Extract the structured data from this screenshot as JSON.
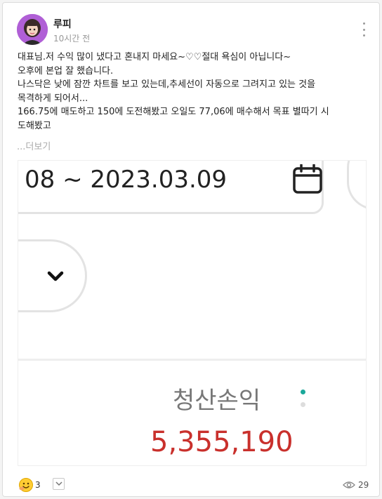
{
  "post": {
    "author": "루피",
    "time": "10시간 전",
    "body": "대표님.저 수익 많이  냈다고 혼내지 마세요~♡♡절대 욕심이 아닙니다~\n오후에 본업 잘 했습니다.\n나스닥은 낮에 잠깐 차트를 보고  있는데,추세선이 자동으로 그려지고 있는 것을\n목격하게 되어서...\n166.75에 매도하고 150에 도전해봤고 오일도 77,06에 매수해서 목표 별따기 시\n도해봤고",
    "more_label": "...더보기"
  },
  "screenshot": {
    "date_range": "08 ~ 2023.03.09",
    "pnl_label": "청산손익",
    "pnl_value": "5,355,190"
  },
  "footer": {
    "reaction_count": "3",
    "view_count": "29"
  },
  "icons": {
    "more": "more-vertical-icon",
    "calendar": "calendar-icon",
    "chevron": "chevron-down-icon",
    "emoji": "smiley-emoji-icon",
    "eye": "eye-icon"
  },
  "colors": {
    "pnl_value": "#c9302c",
    "avatar_bg": "#b05fd6",
    "muted_text": "#999999"
  }
}
